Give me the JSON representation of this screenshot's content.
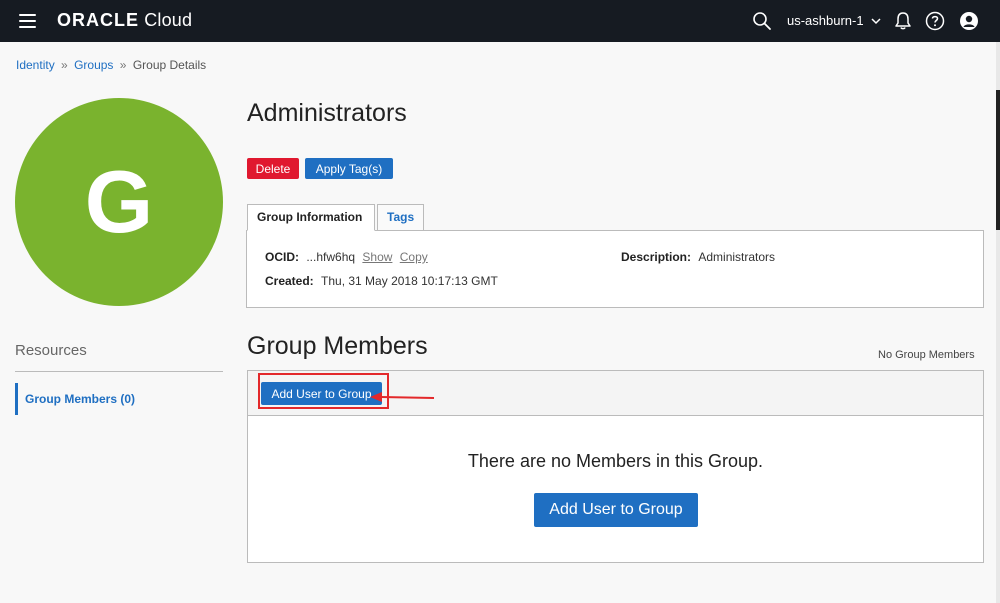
{
  "topbar": {
    "brand_oracle": "ORACLE",
    "brand_cloud": "Cloud",
    "region": "us-ashburn-1",
    "bg_color": "#161b22"
  },
  "breadcrumb": {
    "items": [
      "Identity",
      "Groups",
      "Group Details"
    ],
    "separator": "»"
  },
  "avatar": {
    "letter": "G",
    "color": "#7ab32e"
  },
  "resources": {
    "title": "Resources",
    "items": [
      {
        "label": "Group Members (0)"
      }
    ]
  },
  "group": {
    "title": "Administrators",
    "actions": {
      "delete_label": "Delete",
      "tag_label": "Apply Tag(s)"
    },
    "tabs": [
      {
        "label": "Group Information"
      },
      {
        "label": "Tags"
      }
    ],
    "info": {
      "ocid_label": "OCID:",
      "ocid_value": "...hfw6hq",
      "show_label": "Show",
      "copy_label": "Copy",
      "created_label": "Created:",
      "created_value": "Thu, 31 May 2018 10:17:13 GMT",
      "description_label": "Description:",
      "description_value": "Administrators"
    }
  },
  "members": {
    "title": "Group Members",
    "count_text": "No Group Members",
    "add_button_label": "Add User to Group",
    "empty_text": "There are no Members in this Group.",
    "add_button_big_label": "Add User to Group"
  },
  "colors": {
    "accent": "#1f6fc2",
    "danger": "#e0182f",
    "highlight": "#e3282a"
  }
}
